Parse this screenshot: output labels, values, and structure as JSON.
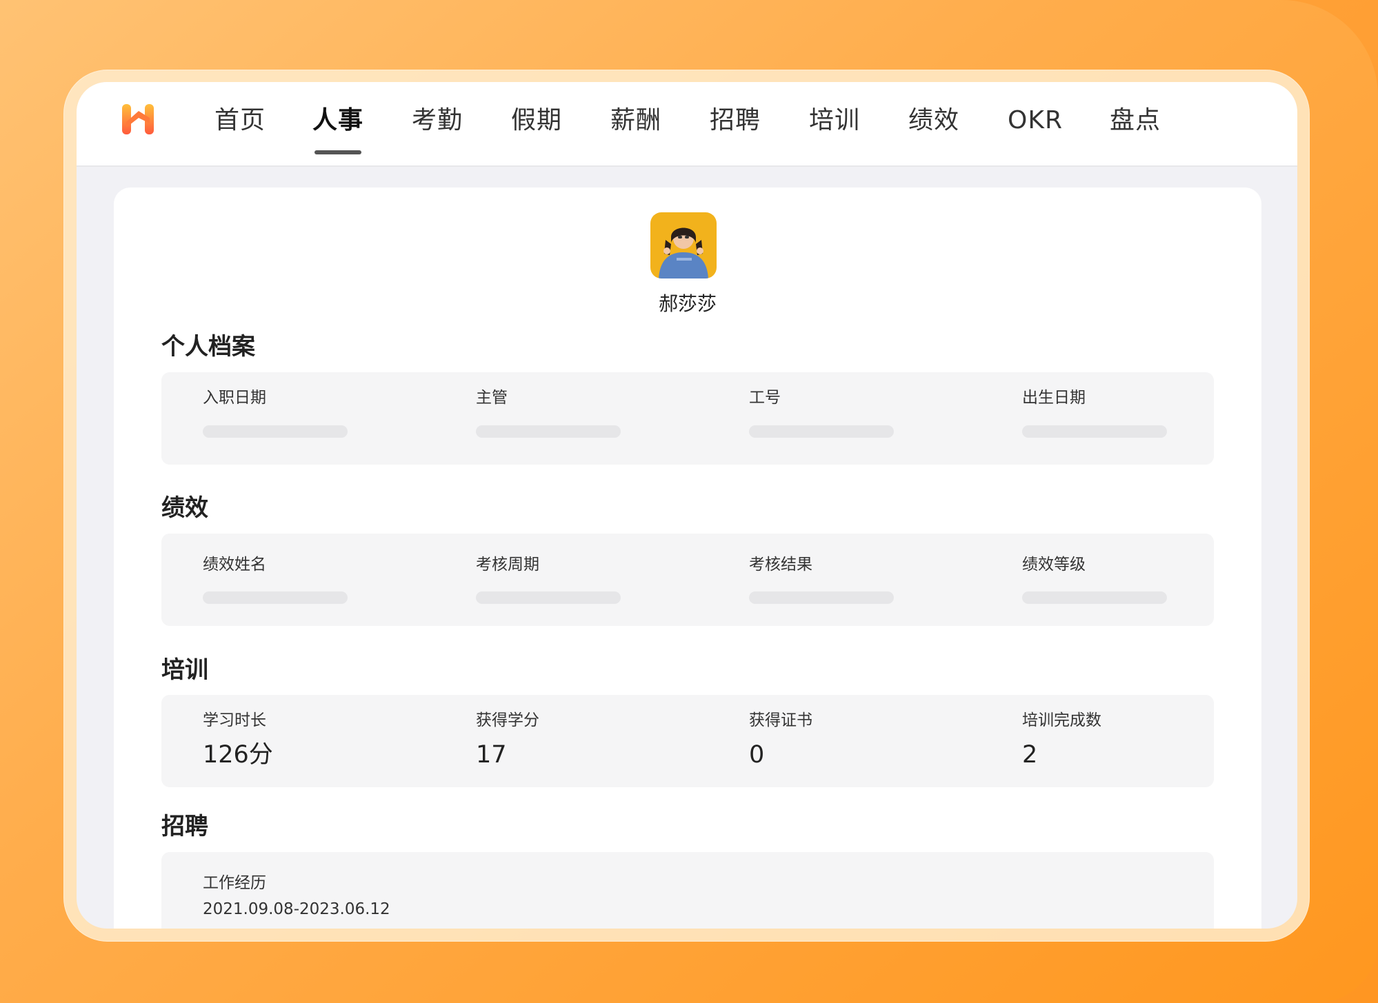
{
  "colors": {
    "background_orange": "#ff9d2e",
    "logo_gradient_top": "#ffbf3b",
    "logo_gradient_bottom": "#ff5a3c",
    "active_tab_underline": "#555555"
  },
  "app": {
    "logo_icon": "h-logo-icon"
  },
  "nav": {
    "items": [
      {
        "label": "首页",
        "active": false
      },
      {
        "label": "人事",
        "active": true
      },
      {
        "label": "考勤",
        "active": false
      },
      {
        "label": "假期",
        "active": false
      },
      {
        "label": "薪酬",
        "active": false
      },
      {
        "label": "招聘",
        "active": false
      },
      {
        "label": "培训",
        "active": false
      },
      {
        "label": "绩效",
        "active": false
      },
      {
        "label": "OKR",
        "active": false
      },
      {
        "label": "盘点",
        "active": false
      }
    ]
  },
  "profile": {
    "avatar_icon": "user-avatar-photo",
    "name": "郝莎莎"
  },
  "sections": {
    "personal": {
      "title": "个人档案",
      "fields": [
        {
          "label": "入职日期"
        },
        {
          "label": "主管"
        },
        {
          "label": "工号"
        },
        {
          "label": "出生日期"
        }
      ]
    },
    "performance": {
      "title": "绩效",
      "fields": [
        {
          "label": "绩效姓名"
        },
        {
          "label": "考核周期"
        },
        {
          "label": "考核结果"
        },
        {
          "label": "绩效等级"
        }
      ]
    },
    "training": {
      "title": "培训",
      "fields": [
        {
          "label": "学习时长",
          "value": "126分"
        },
        {
          "label": "获得学分",
          "value": "17"
        },
        {
          "label": "获得证书",
          "value": "0"
        },
        {
          "label": "培训完成数",
          "value": "2"
        }
      ]
    },
    "recruiting": {
      "title": "招聘",
      "work_experience_label": "工作经历",
      "work_experience_value": "2021.09.08-2023.06.12"
    }
  }
}
